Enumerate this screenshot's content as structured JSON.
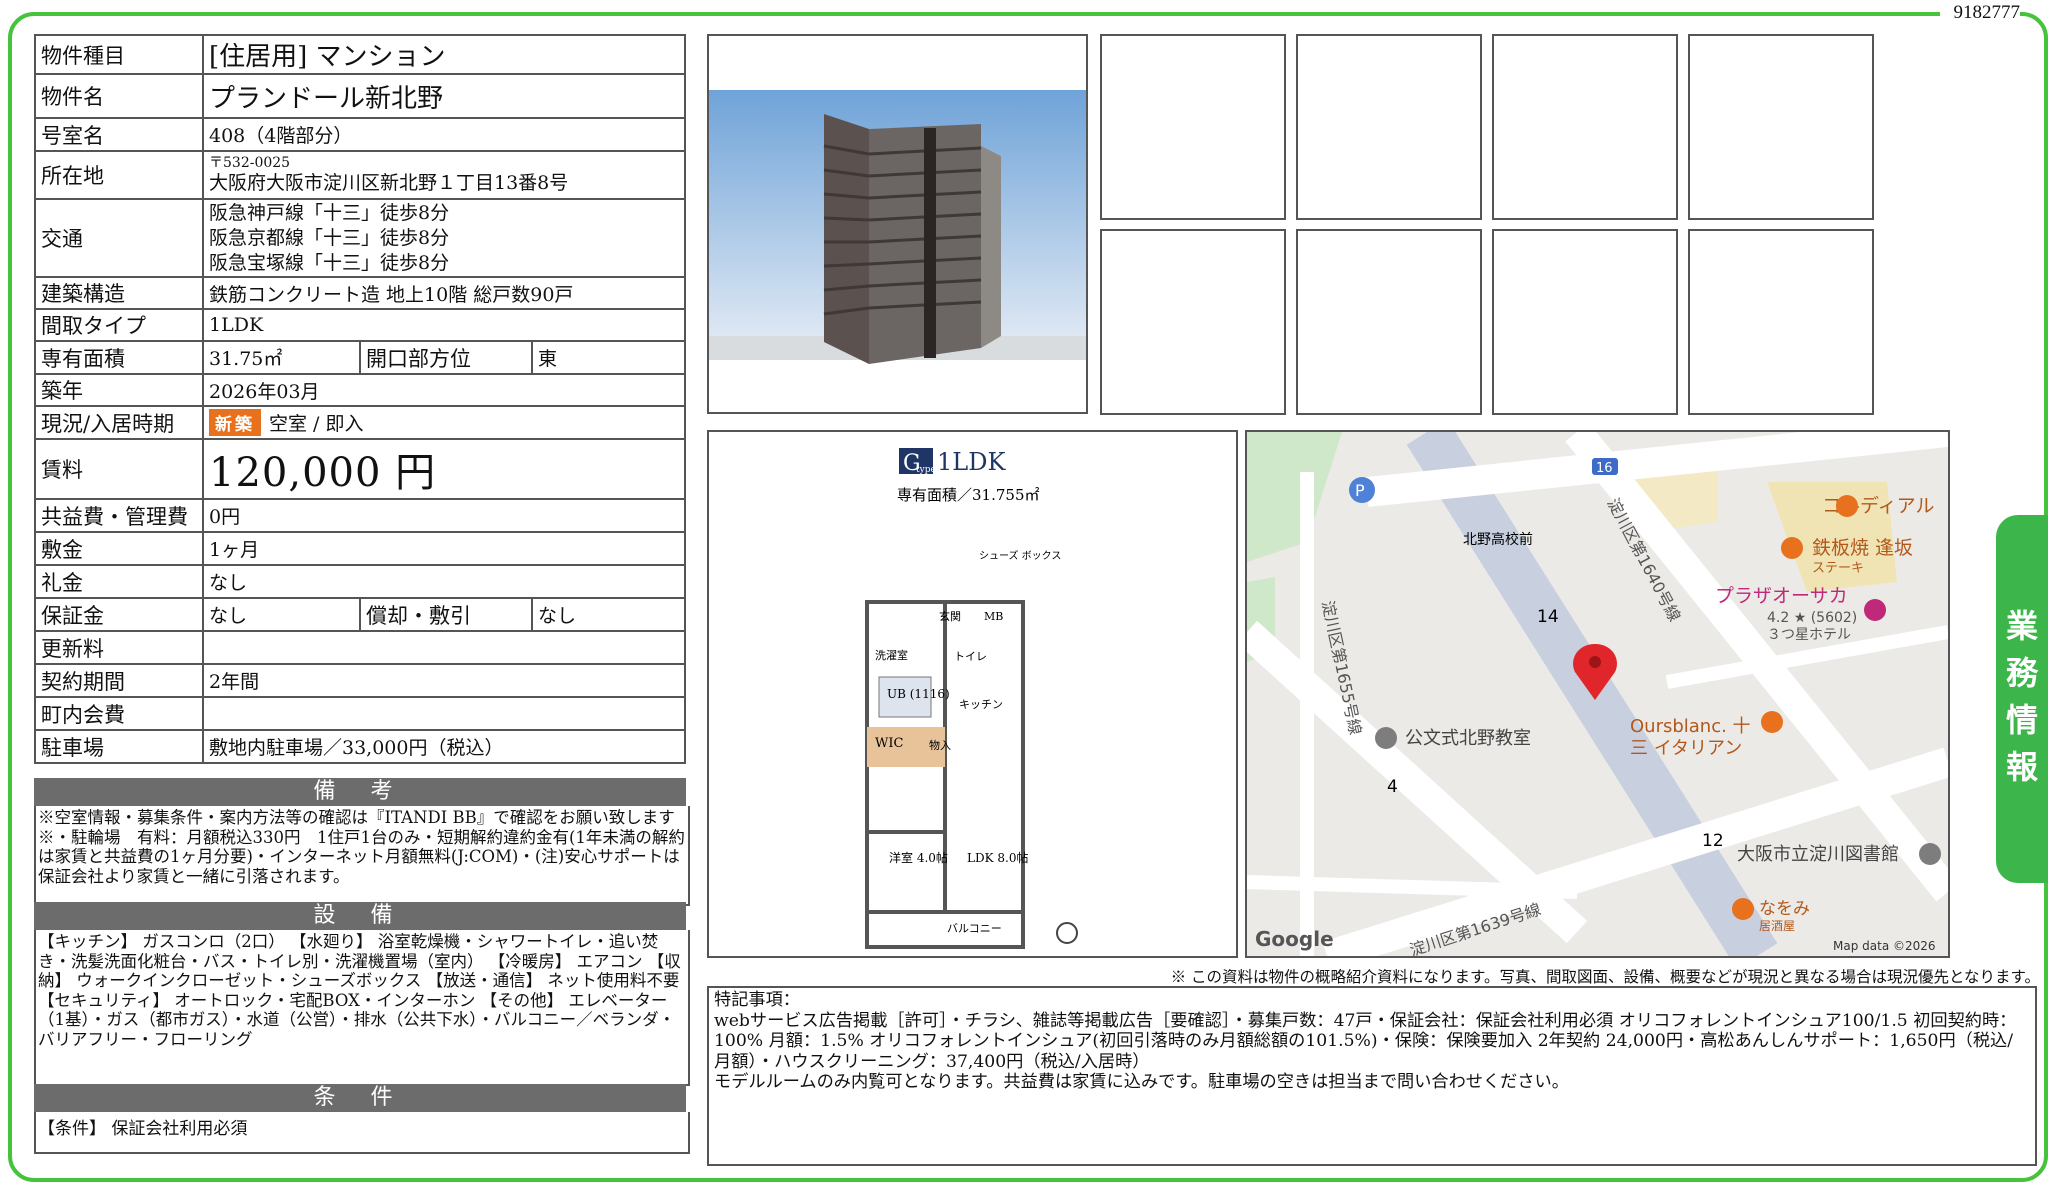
{
  "doc_id": "9182777",
  "property": {
    "type_label": "物件種目",
    "type_value": "[住居用] マンション",
    "name_label": "物件名",
    "name_value": "プランドール新北野",
    "room_label": "号室名",
    "room_value": "408（4階部分）",
    "address_label": "所在地",
    "postal": "〒532-0025",
    "address": "大阪府大阪市淀川区新北野１丁目13番8号",
    "access_label": "交通",
    "access": [
      "阪急神戸線「十三」徒歩8分",
      "阪急京都線「十三」徒歩8分",
      "阪急宝塚線「十三」徒歩8分"
    ],
    "structure_label": "建築構造",
    "structure_value": "鉄筋コンクリート造 地上10階 総戸数90戸",
    "layout_label": "間取タイプ",
    "layout_value": "1LDK",
    "area_label": "専有面積",
    "area_value": "31.75㎡",
    "direction_label": "開口部方位",
    "direction_value": "東",
    "built_label": "築年",
    "built_value": "2026年03月",
    "status_label": "現況/入居時期",
    "status_badge": "新築",
    "status_value": "空室 / 即入",
    "rent_label": "賃料",
    "rent_value": "120,000 円",
    "fee_label": "共益費・管理費",
    "fee_value": "0円",
    "deposit_label": "敷金",
    "deposit_value": "1ヶ月",
    "key_label": "礼金",
    "key_value": "なし",
    "guarantee_label": "保証金",
    "guarantee_value": "なし",
    "amort_label": "償却・敷引",
    "amort_value": "なし",
    "renewal_label": "更新料",
    "renewal_value": "",
    "term_label": "契約期間",
    "term_value": "2年間",
    "town_label": "町内会費",
    "town_value": "",
    "parking_label": "駐車場",
    "parking_value": "敷地内駐車場／33,000円（税込）"
  },
  "remarks": {
    "title": "備 考",
    "text": "※空室情報・募集条件・案内方法等の確認は『ITANDI BB』で確認をお願い致します※・駐輪場　有料：月額税込330円　1住戸1台のみ・短期解約違約金有(1年未満の解約は家賃と共益費の1ヶ月分要)・インターネット月額無料(J:COM)・(注)安心サポートは保証会社より家賃と一緒に引落されます。"
  },
  "equipment": {
    "title": "設 備",
    "text": "【キッチン】 ガスコンロ（2口） 【水廻り】 浴室乾燥機・シャワートイレ・追い焚き・洗髪洗面化粧台・バス・トイレ別・洗濯機置場（室内） 【冷暖房】 エアコン 【収納】 ウォークインクローゼット・シューズボックス 【放送・通信】 ネット使用料不要 【セキュリティ】 オートロック・宅配BOX・インターホン 【その他】 エレベーター（1基）・ガス（都市ガス）・水道（公営）・排水（公共下水）・バルコニー／ベランダ・バリアフリー・フローリング"
  },
  "conditions": {
    "title": "条 件",
    "text": "【条件】 保証会社利用必須"
  },
  "floorplan": {
    "type_label": "G",
    "type_small": "type",
    "layout": "1LDK",
    "area_text": "専有面積／31.755㎡",
    "rooms": {
      "shoes": "シューズ\nボックス",
      "entrance": "玄関",
      "mb": "MB",
      "wash": "洗濯室",
      "toilet": "トイレ",
      "ub": "UB\n(1116)",
      "kitchen": "キッチン",
      "wic": "WIC",
      "storage": "物入",
      "western": "洋室\n4.0帖",
      "ldk": "LDK\n8.0帖",
      "balcony": "バルコニー"
    }
  },
  "map": {
    "labels": {
      "route16": "16",
      "kitano_hs": "北野高校前",
      "cordial": "コルディアル",
      "teppan": "鉄板焼 逢坂",
      "teppan_sub": "ステーキ",
      "plaza": "プラザオーサカ",
      "plaza_rating": "4.2 ★ (5602)",
      "plaza_sub": "３つ星ホテル",
      "road1640": "淀川区第1640号線",
      "road1655": "淀川区第1655号線",
      "road1639": "淀川区第1639号線",
      "kumon": "公文式北野教室",
      "oursblanc": "Oursblanc. 十",
      "oursblanc2": "三 イタリアン",
      "library": "大阪市立淀川図書館",
      "nakami": "なをみ",
      "nakami_sub": "居酒屋",
      "block14": "14",
      "block4": "4",
      "block12": "12",
      "google": "Google",
      "mapdata": "Map data ©2026",
      "parking": "P"
    },
    "accent": "#e8711e",
    "pin": "#e0262a"
  },
  "note": "※ この資料は物件の概略紹介資料になります。写真、間取図面、設備、概要などが現況と異なる場合は現況優先となります。",
  "tokki": {
    "title": "特記事項：",
    "body": "webサービス広告掲載［許可］・チラシ、雑誌等掲載広告［要確認］・募集戸数：47戸・保証会社：保証会社利用必須 オリコフォレントインシュア100/1.5 初回契約時：100% 月額：1.5% オリコフォレントインシュア(初回引落時のみ月額総額の101.5%)・保険：保険要加入 2年契約 24,000円・高松あんしんサポート：1,650円（税込/月額）・ハウスクリーニング：37,400円（税込/入居時）",
    "body2": "モデルルームのみ内覧可となります。共益費は家賃に込みです。駐車場の空きは担当まで問い合わせください。"
  },
  "side_tab": [
    "業",
    "務",
    "情",
    "報"
  ],
  "colors": {
    "frame": "#46c23c",
    "header_bg": "#6c6c6c",
    "badge": "#e8711e"
  }
}
